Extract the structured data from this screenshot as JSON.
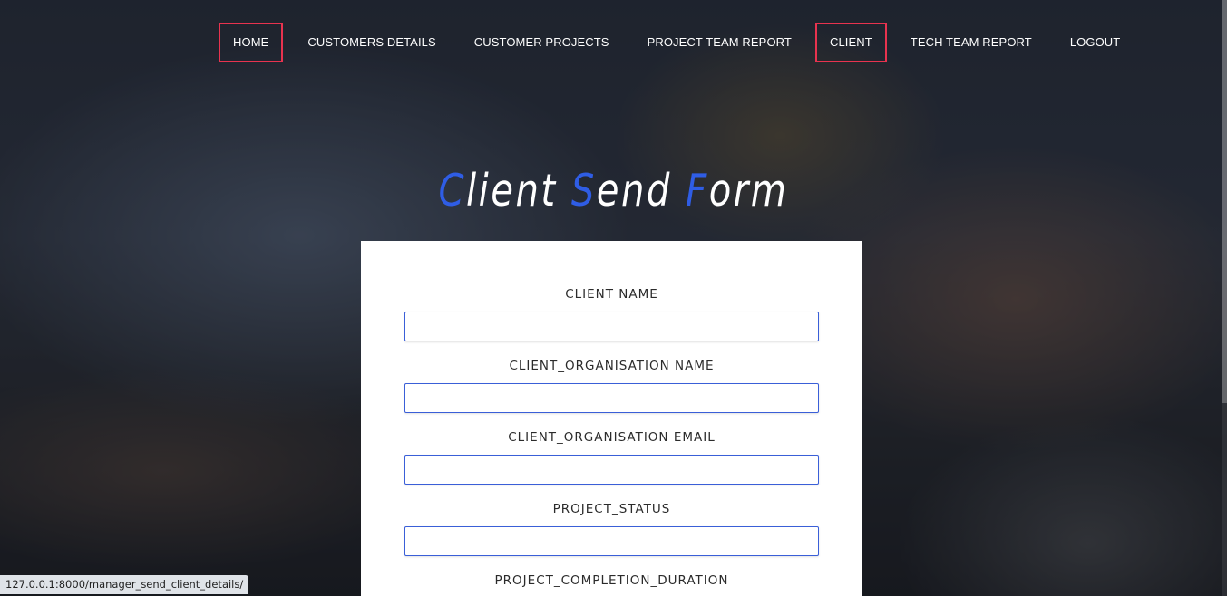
{
  "nav": {
    "items": [
      {
        "label": "HOME"
      },
      {
        "label": "CUSTOMERS DETAILS"
      },
      {
        "label": "CUSTOMER PROJECTS"
      },
      {
        "label": "PROJECT TEAM REPORT"
      },
      {
        "label": "CLIENT"
      },
      {
        "label": "TECH TEAM REPORT"
      },
      {
        "label": "LOGOUT"
      }
    ]
  },
  "heading": {
    "part1_initial": "C",
    "part1_rest": "lient",
    "part2_initial": "S",
    "part2_rest": "end",
    "part3_initial": "F",
    "part3_rest": "orm"
  },
  "form": {
    "fields": [
      {
        "label": "CLIENT NAME",
        "value": ""
      },
      {
        "label": "CLIENT_ORGANISATION NAME",
        "value": ""
      },
      {
        "label": "CLIENT_ORGANISATION EMAIL",
        "value": ""
      },
      {
        "label": "PROJECT_STATUS",
        "value": ""
      },
      {
        "label": "PROJECT_COMPLETION_DURATION",
        "value": ""
      }
    ]
  },
  "status_bar": {
    "url": "127.0.0.1:8000/manager_send_client_details/"
  },
  "colors": {
    "accent_blue": "#2f5de5",
    "nav_highlight_border": "#e8334f"
  }
}
